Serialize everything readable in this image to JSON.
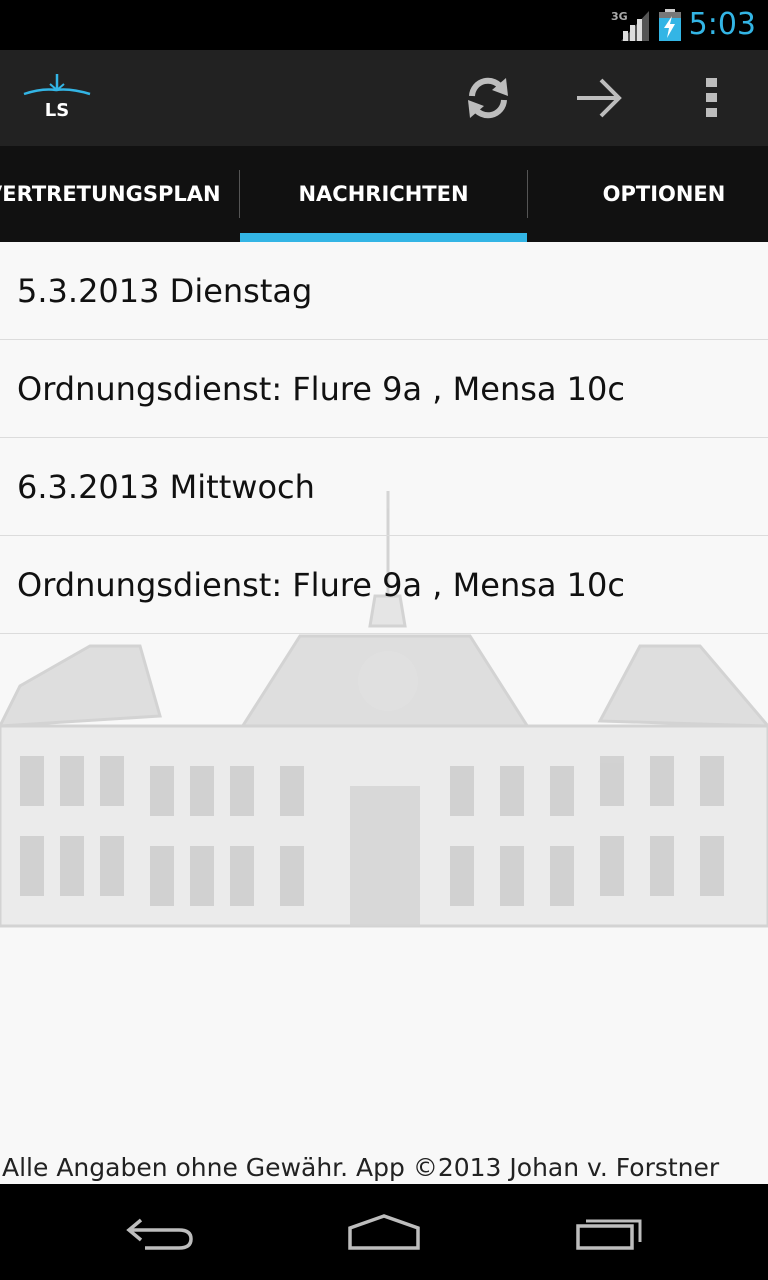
{
  "status_bar": {
    "network_label": "3G",
    "time": "5:03",
    "icons": [
      "signal-3g-icon",
      "battery-charging-icon"
    ]
  },
  "action_bar": {
    "logo_text": "LS",
    "icons": [
      "refresh-icon",
      "arrow-forward-icon",
      "overflow-menu-icon"
    ]
  },
  "tabs": [
    {
      "label": "VERTRETUNGSPLAN",
      "selected": false
    },
    {
      "label": "NACHRICHTEN",
      "selected": true
    },
    {
      "label": "OPTIONEN",
      "selected": false
    }
  ],
  "messages": [
    "5.3.2013 Dienstag",
    "Ordnungsdienst: Flure 9a , Mensa 10c",
    "6.3.2013 Mittwoch",
    "Ordnungsdienst: Flure 9a , Mensa 10c"
  ],
  "footer": "Alle Angaben ohne Gewähr. App ©2013 Johan v. Forstner",
  "colors": {
    "accent": "#33b5e5",
    "action_bar": "#222222",
    "tab_bar": "#111111",
    "content_bg": "#f8f8f8"
  },
  "nav_bar": {
    "icons": [
      "back-icon",
      "home-icon",
      "recent-apps-icon"
    ]
  }
}
